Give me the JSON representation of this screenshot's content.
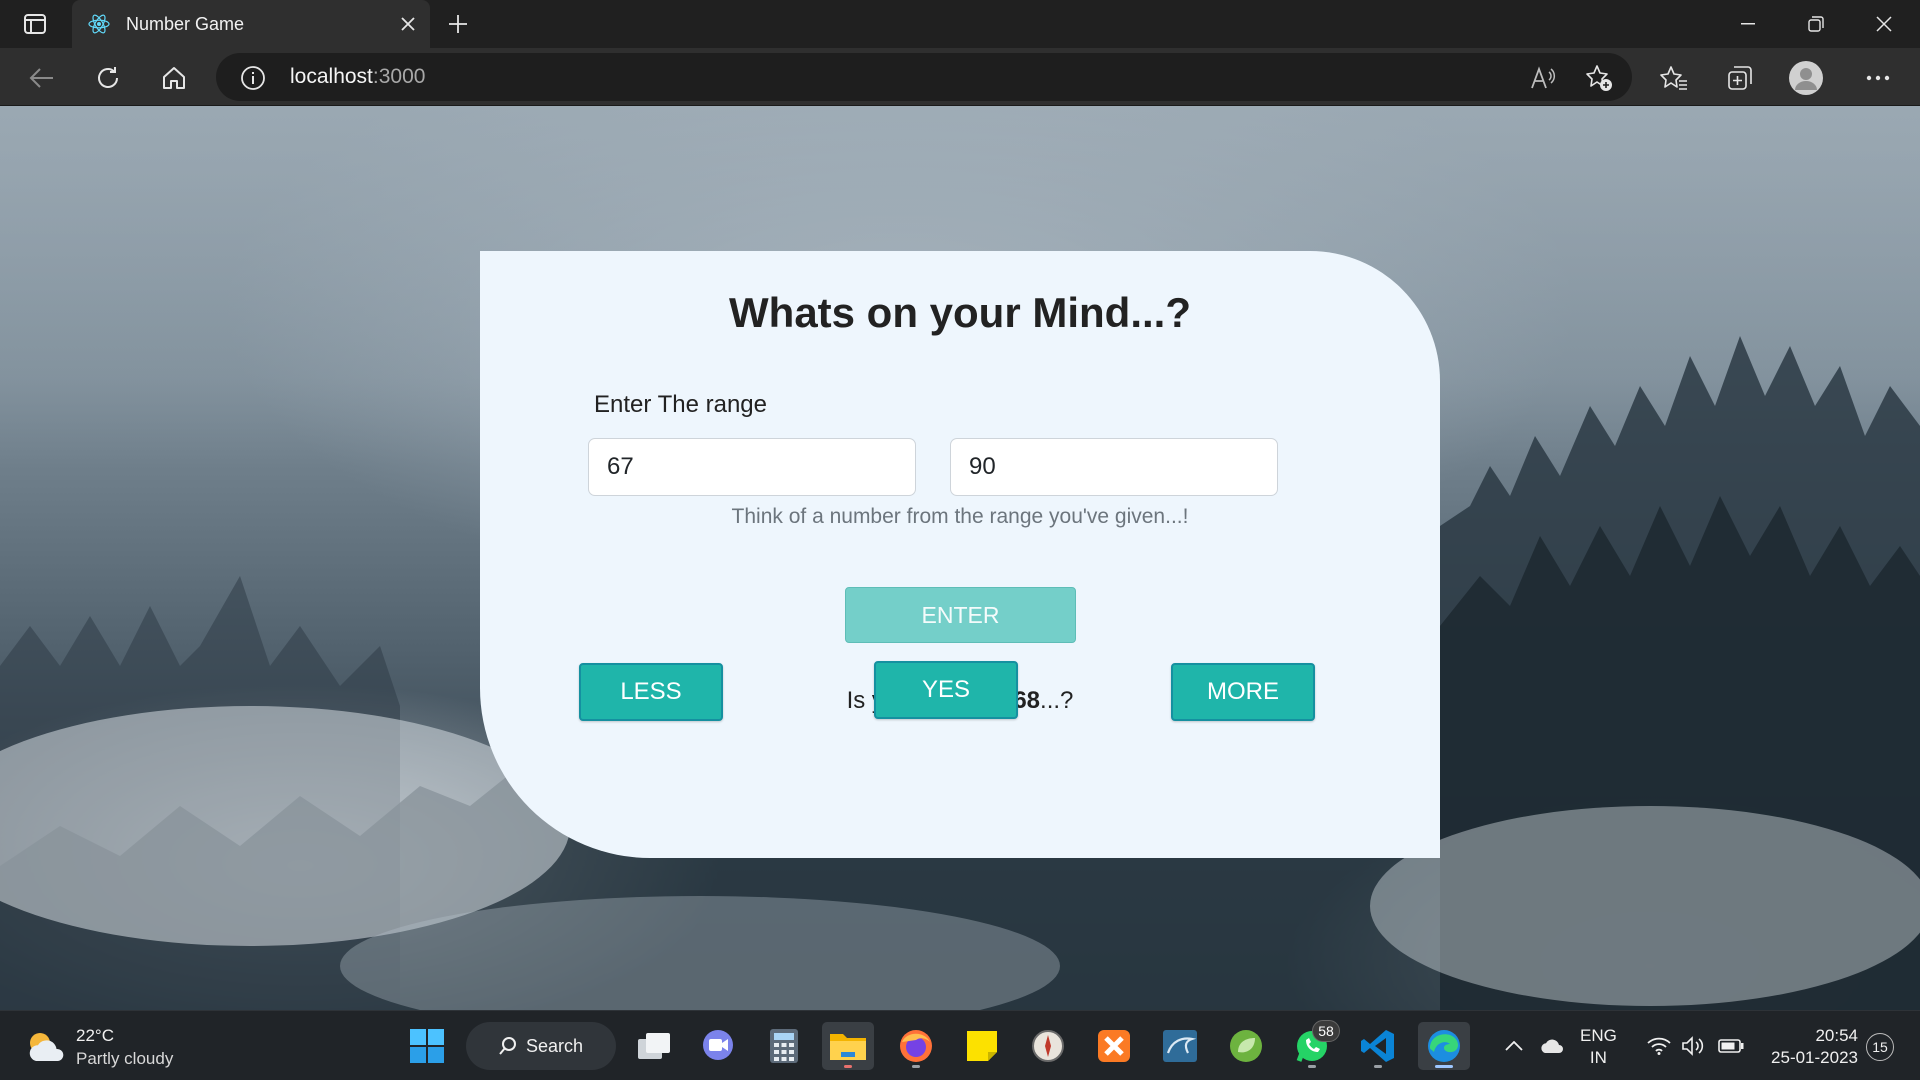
{
  "browser": {
    "tab_title": "Number Game",
    "url_host": "localhost",
    "url_port": ":3000"
  },
  "page": {
    "title": "Whats on your Mind...?",
    "range_label": "Enter The range",
    "range_from": "67",
    "range_to": "90",
    "hint": "Think of a number from the range you've given...!",
    "enter_label": "ENTER",
    "question_prefix": "Is your number ",
    "guess": "68",
    "question_suffix": "...?",
    "less_label": "LESS",
    "yes_label": "YES",
    "more_label": "MORE"
  },
  "taskbar": {
    "weather_temp": "22°C",
    "weather_desc": "Partly cloudy",
    "search_label": "Search",
    "whatsapp_badge": "58",
    "lang_top": "ENG",
    "lang_bottom": "IN",
    "time": "20:54",
    "date": "25-01-2023",
    "notification_count": "15"
  },
  "colors": {
    "card_bg": "#eef6fd",
    "enter_button": "#74cfc9",
    "action_button": "#1fb5aa",
    "taskbar_bg": "#202428"
  }
}
